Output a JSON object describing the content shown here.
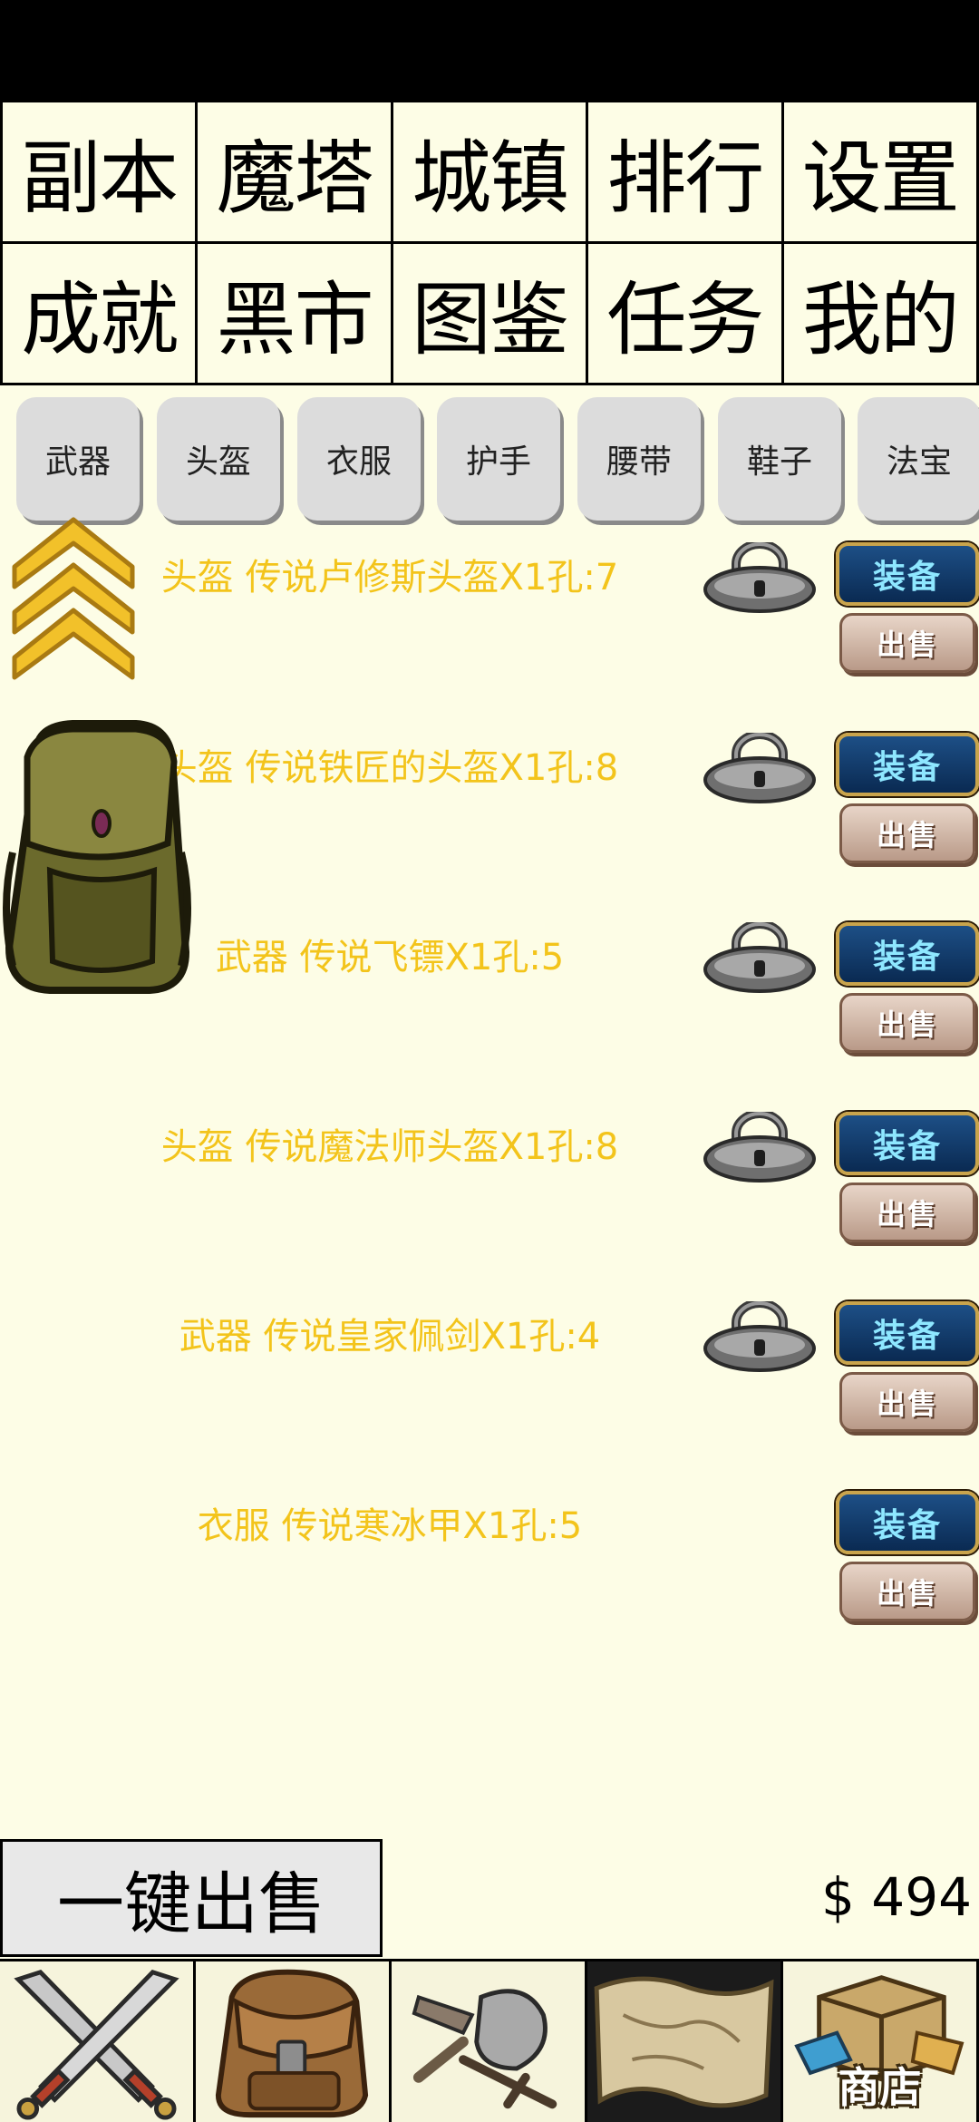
{
  "menu": {
    "row1": [
      "副本",
      "魔塔",
      "城镇",
      "排行",
      "设置"
    ],
    "row2": [
      "成就",
      "黑市",
      "图鉴",
      "任务",
      "我的"
    ]
  },
  "categories": [
    "武器",
    "头盔",
    "衣服",
    "护手",
    "腰带",
    "鞋子",
    "法宝"
  ],
  "items": [
    {
      "name": "头盔 传说卢修斯头盔X1孔:7",
      "locked_icon": true
    },
    {
      "name": "头盔 传说铁匠的头盔X1孔:8",
      "locked_icon": true
    },
    {
      "name": "武器 传说飞镖X1孔:5",
      "locked_icon": true
    },
    {
      "name": "头盔 传说魔法师头盔X1孔:8",
      "locked_icon": true
    },
    {
      "name": "武器 传说皇家佩剑X1孔:4",
      "locked_icon": true
    },
    {
      "name": "衣服 传说寒冰甲X1孔:5",
      "locked_icon": false
    }
  ],
  "buttons": {
    "equip_label": "装备",
    "sell_label": "出售",
    "sell_all_label": "一键出售"
  },
  "money": "$ 494",
  "bottom_nav": {
    "shop_label": "商店",
    "icons": [
      "crossed-swords-icon",
      "backpack-icon",
      "fist-weapons-icon",
      "map-scroll-icon",
      "shop-icon"
    ]
  },
  "colors": {
    "background": "#fdfde6",
    "item_text": "#f3c41b",
    "equip_button": "#0a2a52",
    "sell_button": "#c9ad9c"
  }
}
